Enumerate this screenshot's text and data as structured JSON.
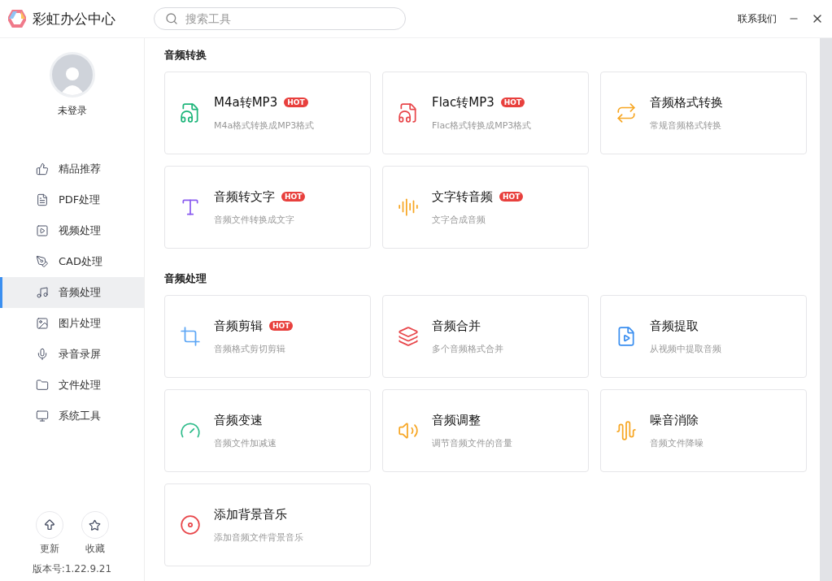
{
  "app": {
    "title": "彩虹办公中心"
  },
  "search": {
    "placeholder": "搜索工具"
  },
  "header_links": {
    "contact": "联系我们"
  },
  "user": {
    "status": "未登录"
  },
  "nav": [
    {
      "label": "精品推荐",
      "selected": false
    },
    {
      "label": "PDF处理",
      "selected": false
    },
    {
      "label": "视频处理",
      "selected": false
    },
    {
      "label": "CAD处理",
      "selected": false
    },
    {
      "label": "音频处理",
      "selected": true
    },
    {
      "label": "图片处理",
      "selected": false
    },
    {
      "label": "录音录屏",
      "selected": false
    },
    {
      "label": "文件处理",
      "selected": false
    },
    {
      "label": "系统工具",
      "selected": false
    }
  ],
  "footer": {
    "update": "更新",
    "favorite": "收藏",
    "version": "版本号:1.22.9.21"
  },
  "sections": [
    {
      "title": "音频转换",
      "tools": [
        {
          "name": "M4a转MP3",
          "badge": "HOT",
          "desc": "M4a格式转换成MP3格式",
          "color": "#1db57a"
        },
        {
          "name": "Flac转MP3",
          "badge": "HOT",
          "desc": "Flac格式转换成MP3格式",
          "color": "#e8474b"
        },
        {
          "name": "音频格式转换",
          "desc": "常规音频格式转换",
          "color": "#f7a623"
        },
        {
          "name": "音频转文字",
          "badge": "HOT",
          "desc": "音频文件转换成文字",
          "color": "#8a5cf0"
        },
        {
          "name": "文字转音频",
          "badge": "HOT",
          "desc": "文字合成音频",
          "color": "#f7a623"
        }
      ]
    },
    {
      "title": "音频处理",
      "tools": [
        {
          "name": "音频剪辑",
          "badge": "HOT",
          "desc": "音频格式剪切剪辑",
          "color": "#5aa5f5"
        },
        {
          "name": "音频合并",
          "desc": "多个音频格式合并",
          "color": "#e8474b"
        },
        {
          "name": "音频提取",
          "desc": "从视频中提取音频",
          "color": "#3b8ff0"
        },
        {
          "name": "音频变速",
          "desc": "音频文件加减速",
          "color": "#2dbb8a"
        },
        {
          "name": "音频调整",
          "desc": "调节音频文件的音量",
          "color": "#f7a623"
        },
        {
          "name": "噪音消除",
          "desc": "音频文件降噪",
          "color": "#f7a623"
        },
        {
          "name": "添加背景音乐",
          "desc": "添加音频文件背景音乐",
          "color": "#e8474b"
        }
      ]
    }
  ]
}
